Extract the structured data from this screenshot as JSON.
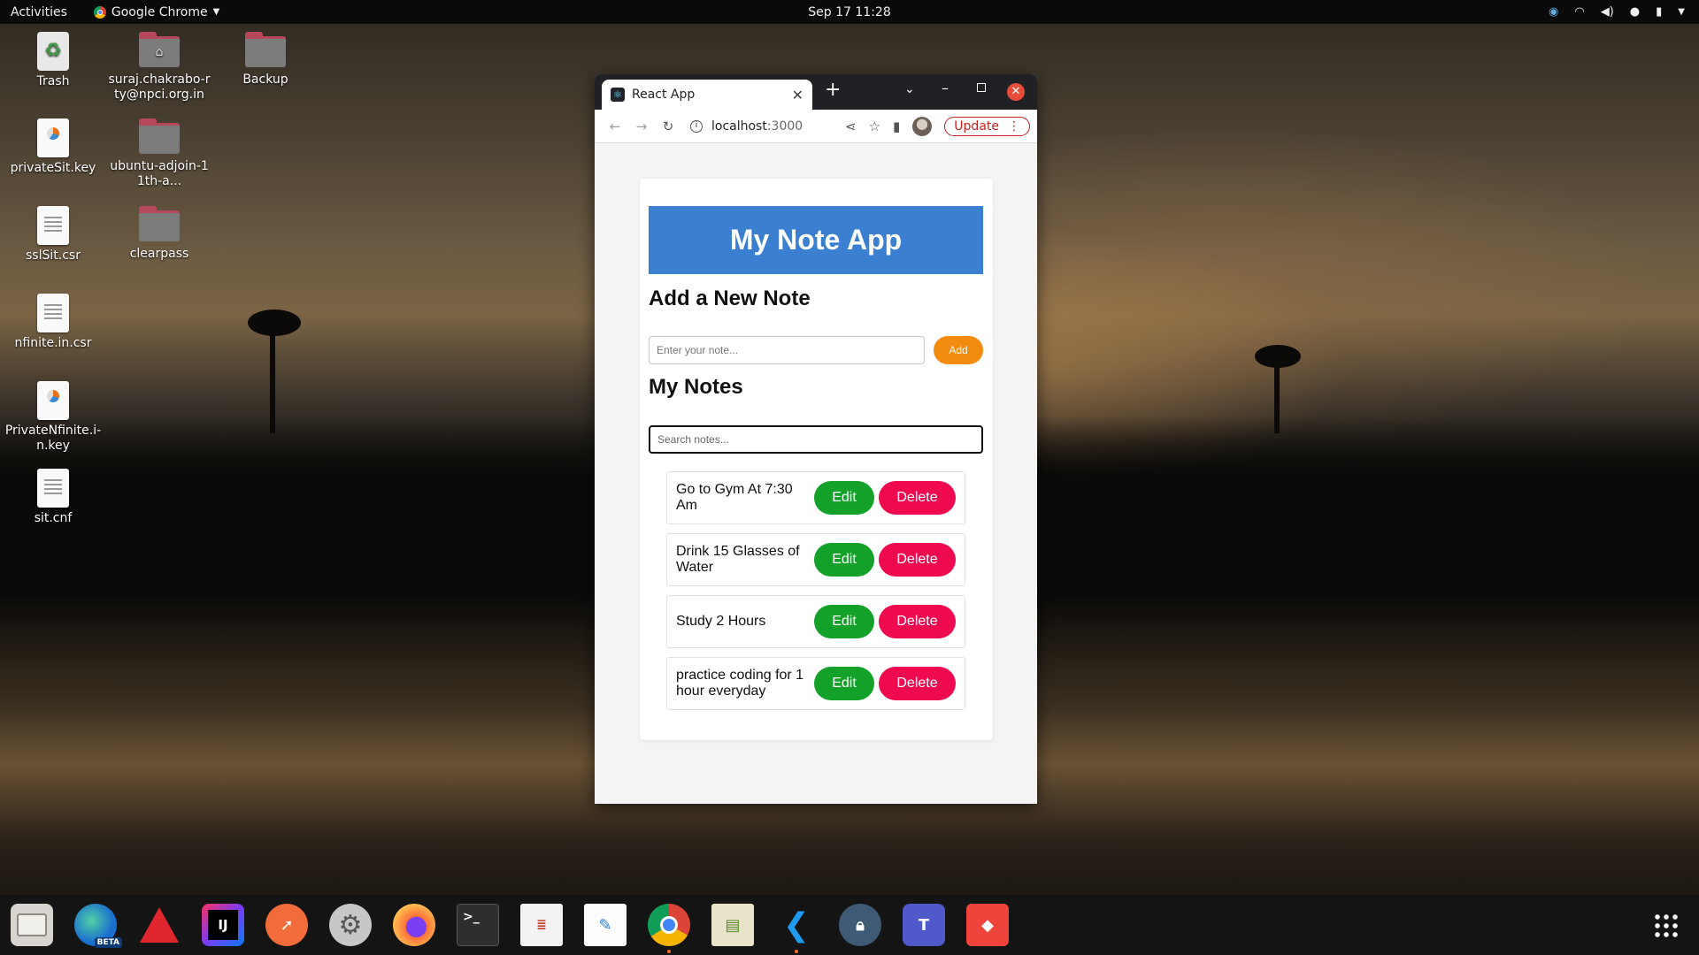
{
  "topbar": {
    "activities": "Activities",
    "app_name": "Google Chrome",
    "clock": "Sep 17  11:28"
  },
  "desktop_icons": [
    {
      "label": "Trash",
      "icon": "trash-icon"
    },
    {
      "label": "suraj.chakrabo-rty@npci.org.in",
      "icon": "home-folder-icon"
    },
    {
      "label": "Backup",
      "icon": "folder-icon"
    },
    {
      "label": "privateSit.key",
      "icon": "key-file-icon"
    },
    {
      "label": "ubuntu-adjoin-11th-a...",
      "icon": "folder-icon"
    },
    {
      "label": "sslSit.csr",
      "icon": "text-file-icon"
    },
    {
      "label": "clearpass",
      "icon": "folder-icon"
    },
    {
      "label": "nfinite.in.csr",
      "icon": "text-file-icon"
    },
    {
      "label": "PrivateNfinite.i-n.key",
      "icon": "key-file-icon"
    },
    {
      "label": "sit.cnf",
      "icon": "text-file-icon"
    }
  ],
  "browser": {
    "tab_title": "React App",
    "url_host": "localhost",
    "url_port": ":3000",
    "update_label": "Update"
  },
  "app": {
    "title": "My Note App",
    "add_section_title": "Add a New Note",
    "note_placeholder": "Enter your note...",
    "add_button": "Add",
    "notes_section_title": "My Notes",
    "search_placeholder": "Search notes...",
    "edit_label": "Edit",
    "delete_label": "Delete",
    "notes": [
      "Go to Gym At 7:30 Am",
      "Drink 15 Glasses of Water",
      "Study 2 Hours",
      "practice coding for 1 hour everyday"
    ]
  },
  "colors": {
    "app_header": "#3a7fd0",
    "add_button": "#f28c10",
    "edit_button": "#14a12a",
    "delete_button": "#ef0a4f"
  },
  "dock": {
    "items": [
      "files-icon",
      "edge-beta-icon",
      "angular-icon",
      "intellij-icon",
      "postman-icon",
      "settings-icon",
      "firefox-icon",
      "terminal-icon",
      "document-viewer-icon",
      "text-editor-icon",
      "chrome-icon",
      "file-roller-icon",
      "vscode-icon",
      "vpn-icon",
      "teams-icon",
      "anydesk-icon"
    ],
    "edge_badge": "BETA"
  }
}
